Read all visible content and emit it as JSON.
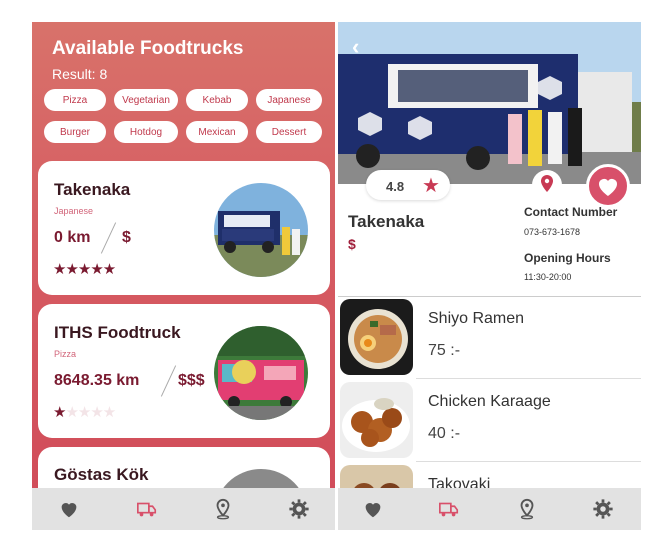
{
  "list_screen": {
    "title": "Available Foodtrucks",
    "result": "Result: 8",
    "filters": [
      "Pizza",
      "Vegetarian",
      "Kebab",
      "Japanese",
      "Burger",
      "Hotdog",
      "Mexican",
      "Dessert"
    ],
    "trucks": [
      {
        "name": "Takenaka",
        "category": "Japanese",
        "distance": "0 km",
        "price": "$",
        "rating": 5
      },
      {
        "name": "ITHS Foodtruck",
        "category": "Pizza",
        "distance": "8648.35 km",
        "price": "$$$",
        "rating": 1
      },
      {
        "name": "Göstas Kök"
      }
    ]
  },
  "detail_screen": {
    "rating": "4.8",
    "name": "Takenaka",
    "price": "$",
    "contact_label": "Contact Number",
    "contact_value": "073-673-1678",
    "hours_label": "Opening Hours",
    "hours_value": "11:30-20:00",
    "menu": [
      {
        "name": "Shiyo Ramen",
        "price": "75 :-"
      },
      {
        "name": "Chicken Karaage",
        "price": "40 :-"
      },
      {
        "name": "Takovaki"
      }
    ]
  },
  "nav": [
    "heart-icon",
    "truck-icon",
    "map-pin-icon",
    "gear-icon"
  ],
  "colors": {
    "accent": "#c83a54",
    "dark_red": "#7a1a30",
    "nav_bg": "#e2e2e2",
    "active_nav": "#d8506a"
  }
}
